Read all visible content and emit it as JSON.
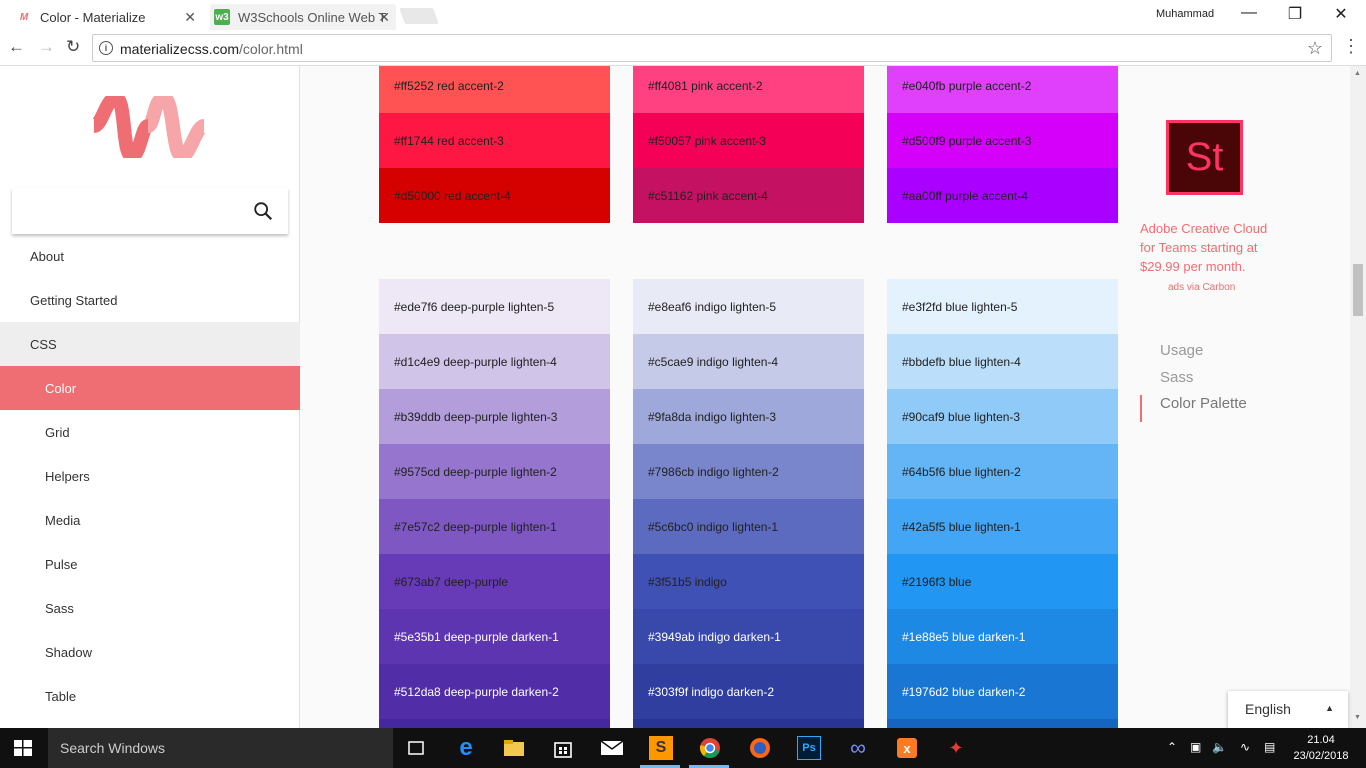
{
  "browser": {
    "tabs": [
      {
        "title": "Color - Materialize",
        "close": "✕"
      },
      {
        "title": "W3Schools Online Web T",
        "close": "✕"
      }
    ],
    "profile_name": "Muhammad",
    "window_controls": {
      "minimize": "—",
      "maximize": "❐",
      "close": "✕"
    },
    "url_host": "materializecss.com",
    "url_path": "/color.html"
  },
  "sidebar": {
    "search_placeholder": "",
    "items": [
      {
        "label": "About",
        "kind": "top"
      },
      {
        "label": "Getting Started",
        "kind": "top"
      },
      {
        "label": "CSS",
        "kind": "section"
      },
      {
        "label": "Color",
        "kind": "active"
      },
      {
        "label": "Grid",
        "kind": "sub"
      },
      {
        "label": "Helpers",
        "kind": "sub"
      },
      {
        "label": "Media",
        "kind": "sub"
      },
      {
        "label": "Pulse",
        "kind": "sub"
      },
      {
        "label": "Sass",
        "kind": "sub"
      },
      {
        "label": "Shadow",
        "kind": "sub"
      },
      {
        "label": "Table",
        "kind": "sub"
      }
    ]
  },
  "palette_top": [
    [
      {
        "label": "#ff5252 red accent-2",
        "color": "#ff5252",
        "text": "dark_text"
      },
      {
        "label": "#ff1744 red accent-3",
        "color": "#ff1744",
        "text": "dark_text"
      },
      {
        "label": "#d50000 red accent-4",
        "color": "#d50000",
        "text": "dark_text"
      }
    ],
    [
      {
        "label": "#ff4081 pink accent-2",
        "color": "#ff4081",
        "text": "dark_text"
      },
      {
        "label": "#f50057 pink accent-3",
        "color": "#f50057",
        "text": "dark_text"
      },
      {
        "label": "#c51162 pink accent-4",
        "color": "#c51162",
        "text": "dark_text"
      }
    ],
    [
      {
        "label": "#e040fb purple accent-2",
        "color": "#e040fb",
        "text": "dark_text"
      },
      {
        "label": "#d500f9 purple accent-3",
        "color": "#d500f9",
        "text": "dark_text"
      },
      {
        "label": "#aa00ff purple accent-4",
        "color": "#aa00ff",
        "text": "dark_text"
      }
    ]
  ],
  "palette_bottom": [
    [
      {
        "label": "#ede7f6 deep-purple lighten-5",
        "color": "#ede7f6",
        "text": "light"
      },
      {
        "label": "#d1c4e9 deep-purple lighten-4",
        "color": "#d1c4e9",
        "text": "light"
      },
      {
        "label": "#b39ddb deep-purple lighten-3",
        "color": "#b39ddb",
        "text": "light"
      },
      {
        "label": "#9575cd deep-purple lighten-2",
        "color": "#9575cd",
        "text": "light"
      },
      {
        "label": "#7e57c2 deep-purple lighten-1",
        "color": "#7e57c2",
        "text": "light"
      },
      {
        "label": "#673ab7 deep-purple",
        "color": "#673ab7",
        "text": "light"
      },
      {
        "label": "#5e35b1 deep-purple darken-1",
        "color": "#5e35b1",
        "text": "dark"
      },
      {
        "label": "#512da8 deep-purple darken-2",
        "color": "#512da8",
        "text": "dark"
      },
      {
        "label": "",
        "color": "#4527a0",
        "text": "dark"
      }
    ],
    [
      {
        "label": "#e8eaf6 indigo lighten-5",
        "color": "#e8eaf6",
        "text": "light"
      },
      {
        "label": "#c5cae9 indigo lighten-4",
        "color": "#c5cae9",
        "text": "light"
      },
      {
        "label": "#9fa8da indigo lighten-3",
        "color": "#9fa8da",
        "text": "light"
      },
      {
        "label": "#7986cb indigo lighten-2",
        "color": "#7986cb",
        "text": "light"
      },
      {
        "label": "#5c6bc0 indigo lighten-1",
        "color": "#5c6bc0",
        "text": "light"
      },
      {
        "label": "#3f51b5 indigo",
        "color": "#3f51b5",
        "text": "light"
      },
      {
        "label": "#3949ab indigo darken-1",
        "color": "#3949ab",
        "text": "dark"
      },
      {
        "label": "#303f9f indigo darken-2",
        "color": "#303f9f",
        "text": "dark"
      },
      {
        "label": "",
        "color": "#283593",
        "text": "dark"
      }
    ],
    [
      {
        "label": "#e3f2fd blue lighten-5",
        "color": "#e3f2fd",
        "text": "light"
      },
      {
        "label": "#bbdefb blue lighten-4",
        "color": "#bbdefb",
        "text": "light"
      },
      {
        "label": "#90caf9 blue lighten-3",
        "color": "#90caf9",
        "text": "light"
      },
      {
        "label": "#64b5f6 blue lighten-2",
        "color": "#64b5f6",
        "text": "light"
      },
      {
        "label": "#42a5f5 blue lighten-1",
        "color": "#42a5f5",
        "text": "light"
      },
      {
        "label": "#2196f3 blue",
        "color": "#2196f3",
        "text": "light"
      },
      {
        "label": "#1e88e5 blue darken-1",
        "color": "#1e88e5",
        "text": "dark"
      },
      {
        "label": "#1976d2 blue darken-2",
        "color": "#1976d2",
        "text": "dark"
      },
      {
        "label": "",
        "color": "#1565c0",
        "text": "dark"
      }
    ]
  ],
  "ad": {
    "logo_text": "St",
    "text": "Adobe Creative Cloud for Teams starting at $29.99 per month.",
    "via": "ads via Carbon"
  },
  "toc": [
    "Usage",
    "Sass",
    "Color Palette"
  ],
  "language": {
    "selected": "English"
  },
  "taskbar": {
    "search_placeholder": "Search Windows",
    "time": "21.04",
    "date": "23/02/2018"
  },
  "colors": {
    "accent": "#ee6e73",
    "taskbar": "#101010"
  }
}
